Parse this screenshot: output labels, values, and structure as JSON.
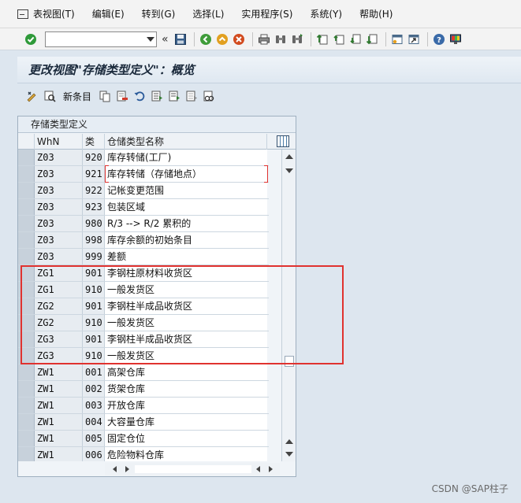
{
  "menu": {
    "items": [
      "表视图(T)",
      "编辑(E)",
      "转到(G)",
      "选择(L)",
      "实用程序(S)",
      "系统(Y)",
      "帮助(H)"
    ]
  },
  "toolbar": {
    "command_value": "",
    "nav_glyph": "«",
    "icons": [
      "check-icon",
      "save-icon",
      "back-icon",
      "exit-icon",
      "cancel-icon",
      "print-icon",
      "find-icon",
      "find-next-icon",
      "first-page-icon",
      "prev-page-icon",
      "next-page-icon",
      "last-page-icon",
      "new-session-icon",
      "shortcut-icon",
      "help-icon",
      "customize-icon"
    ]
  },
  "title": "更改视图\"存储类型定义\"：概览",
  "app_toolbar": {
    "new_entries_label": "新条目"
  },
  "table": {
    "caption": "存储类型定义",
    "headers": {
      "whn": "WhN",
      "type": "类",
      "name": "仓储类型名称"
    },
    "rows": [
      {
        "whn": "Z03",
        "type": "920",
        "name": "库存转储(工厂)"
      },
      {
        "whn": "Z03",
        "type": "921",
        "name": "库存转储（存储地点）"
      },
      {
        "whn": "Z03",
        "type": "922",
        "name": "记帐变更范围"
      },
      {
        "whn": "Z03",
        "type": "923",
        "name": "包装区域"
      },
      {
        "whn": "Z03",
        "type": "980",
        "name": "R/3 --> R/2 累积的"
      },
      {
        "whn": "Z03",
        "type": "998",
        "name": "库存余额的初始条目"
      },
      {
        "whn": "Z03",
        "type": "999",
        "name": "差额"
      },
      {
        "whn": "ZG1",
        "type": "901",
        "name": "李钢柱原材料收货区"
      },
      {
        "whn": "ZG1",
        "type": "910",
        "name": "一般发货区"
      },
      {
        "whn": "ZG2",
        "type": "901",
        "name": "李钢柱半成品收货区"
      },
      {
        "whn": "ZG2",
        "type": "910",
        "name": "一般发货区"
      },
      {
        "whn": "ZG3",
        "type": "901",
        "name": "李钢柱半成品收货区"
      },
      {
        "whn": "ZG3",
        "type": "910",
        "name": "一般发货区"
      },
      {
        "whn": "ZW1",
        "type": "001",
        "name": "高架仓库"
      },
      {
        "whn": "ZW1",
        "type": "002",
        "name": "货架仓库"
      },
      {
        "whn": "ZW1",
        "type": "003",
        "name": "开放仓库"
      },
      {
        "whn": "ZW1",
        "type": "004",
        "name": "大容量仓库"
      },
      {
        "whn": "ZW1",
        "type": "005",
        "name": "固定仓位"
      },
      {
        "whn": "ZW1",
        "type": "006",
        "name": "危险物料仓库"
      }
    ]
  },
  "watermark": "CSDN @SAP柱子",
  "colors": {
    "highlight_border": "#e0322f",
    "background": "#dde6ef"
  }
}
